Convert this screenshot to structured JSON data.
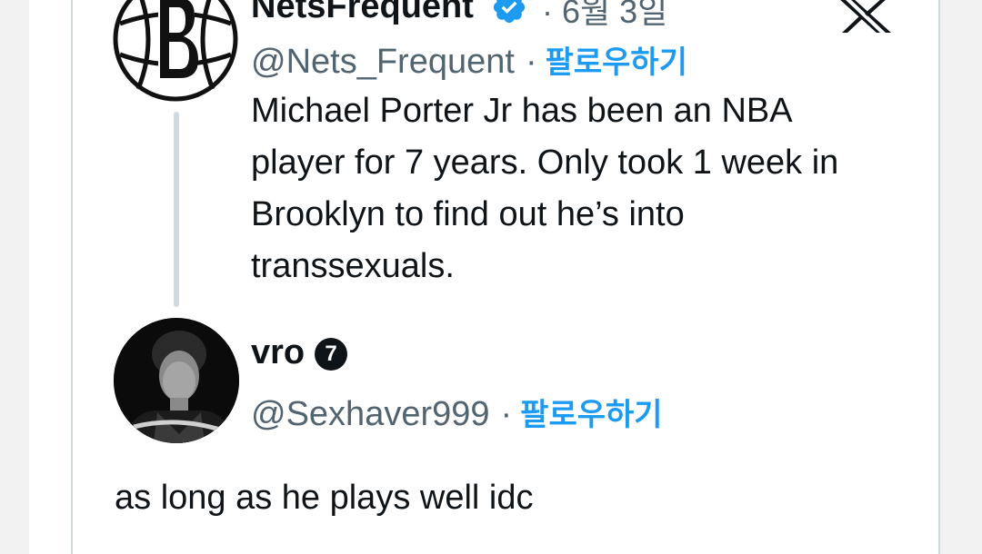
{
  "quoted_tweet": {
    "author_name": "NetsFrequent",
    "date": "· 6월 3일",
    "handle": "@Nets_Frequent",
    "separator": "·",
    "follow_label": "팔로우하기",
    "text_lines": [
      "Michael Porter Jr has been an NBA",
      "player for 7 years. Only took 1 week in",
      "Brooklyn to find out he’s into",
      "transsexuals."
    ]
  },
  "reply_tweet": {
    "author_name": "vro",
    "badge": "7",
    "handle": "@Sexhaver999",
    "separator": "·",
    "follow_label": "팔로우하기",
    "text": "as long as he plays well idc"
  },
  "icons": {
    "verified": "verified-badge-icon",
    "platform": "x-logo-icon"
  },
  "colors": {
    "accent": "#1d9bf0",
    "text": "#0f1419",
    "secondary_text": "#536471",
    "border": "#cfd9de"
  }
}
